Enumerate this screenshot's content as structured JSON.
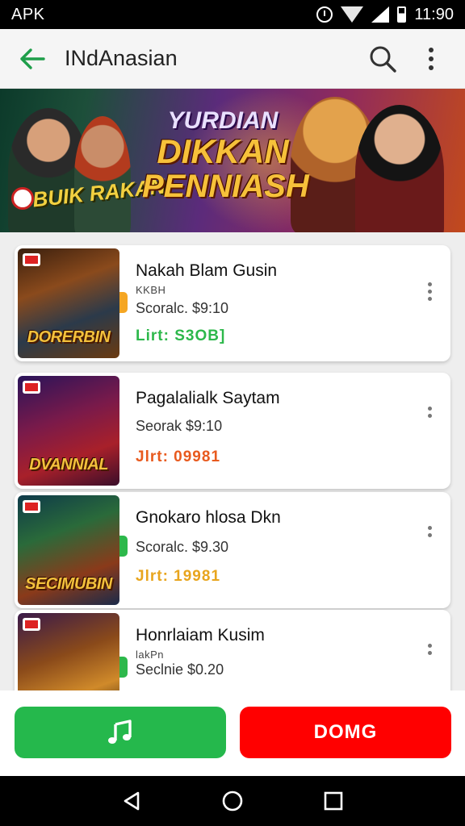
{
  "status_bar": {
    "carrier": "APK",
    "time": "11:90"
  },
  "app_bar": {
    "title": "INdAnasian"
  },
  "banner": {
    "title_line1": "YURDIAN",
    "title_line2": "DIKKAN",
    "title_line3": "PENNIASH",
    "subtitle": "BUIK RAKAN"
  },
  "games": [
    {
      "title": "Nakah Blam Gusin",
      "sub": "KKBH",
      "price": "Scoralc. $9:10",
      "status": "Lirt: S3OB]",
      "logo": "DORERBIN",
      "status_color": "#2db84b",
      "marker_color": "#f5a623",
      "art": "linear-gradient(160deg,#3a1f0e 0%,#8a4a1c 35%,#2b3a4a 65%,#6a3a10 100%)"
    },
    {
      "title": "Pagalalialk Saytam",
      "sub": "",
      "price": "Seorak $9:10",
      "status": "Jlrt: 09981",
      "logo": "DVANNIAL",
      "status_color": "#e85a1e",
      "marker_color": "",
      "art": "linear-gradient(160deg,#2a145a 0%,#7a1a4a 40%,#a8202a 70%,#3a0e2a 100%)"
    },
    {
      "title": "Gnokaro hlosa Dkn",
      "sub": "",
      "price": "Scoralc. $9.30",
      "status": "Jlrt: 19981",
      "logo": "SECIMUBIN",
      "status_color": "#e8a51e",
      "marker_color": "#2db84b",
      "art": "linear-gradient(160deg,#0e3a4a 0%,#2a6a3a 35%,#8a3a1a 70%,#1a2a4a 100%)"
    },
    {
      "title": "Honrlaiam Kusim",
      "sub": "lakPn",
      "price": "Seclnie $0.20",
      "status": "",
      "logo": "",
      "status_color": "#2db84b",
      "marker_color": "#2db84b",
      "art": "linear-gradient(160deg,#3a1a4a 0%,#8a4a1a 40%,#d08a2a 70%,#2a1a0e 100%)"
    }
  ],
  "bottom_bar": {
    "domg_label": "DOMG"
  },
  "colors": {
    "accent_green": "#2db84b",
    "button_green": "#25b84c",
    "button_red": "#ff0000"
  },
  "icons": {
    "back": "arrow-left-icon",
    "search": "search-icon",
    "menu": "more-vertical-icon",
    "music": "music-note-icon"
  }
}
